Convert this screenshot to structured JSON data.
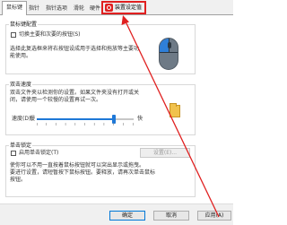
{
  "tabs": [
    {
      "label": "鼠标键"
    },
    {
      "label": "指针"
    },
    {
      "label": "指针选项"
    },
    {
      "label": "滑轮"
    },
    {
      "label": "硬件"
    },
    {
      "label": "装置设定值"
    }
  ],
  "active_tab_index": 0,
  "highlighted_tab_index": 5,
  "highlight_color": "#e02020",
  "button_config": {
    "title": "鼠标键配置",
    "checkbox_label": "切换主要和次要的按钮(S)",
    "checkbox_checked": false,
    "description": [
      "选择此复选框来将右按钮设成用于选择和拖放等主要功",
      "能使用。"
    ]
  },
  "double_click": {
    "title": "双击速度",
    "description": [
      "双击文件夹以检测你的设置。如果文件夹没有打开或关",
      "闭，请使用一个较慢的设置再试一次。"
    ],
    "speed_label": "速度(D):",
    "slow_label": "慢",
    "fast_label": "快",
    "speed_level": 0.8
  },
  "click_lock": {
    "title": "单击锁定",
    "checkbox_label": "启用单击锁定(T)",
    "checkbox_checked": false,
    "settings_button": "设置(E)...",
    "description": [
      "使你可以不用一直按着鼠标按钮就可以突出显示或拖曳。",
      "要进行设置，请短暂按下鼠标按钮。要释放，请再次单击鼠标",
      "按钮。"
    ]
  },
  "footer": {
    "ok": "确定",
    "cancel": "取消",
    "apply": "应用(A)"
  }
}
